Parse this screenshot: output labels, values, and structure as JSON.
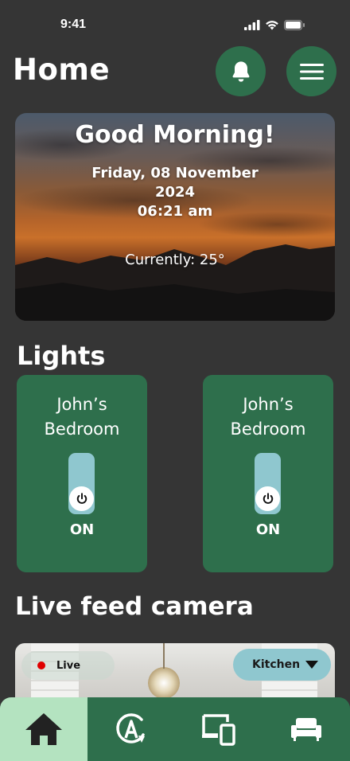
{
  "status": {
    "time": "9:41"
  },
  "header": {
    "title": "Home"
  },
  "hero": {
    "greeting": "Good Morning!",
    "date_line1": "Friday, 08 November",
    "date_line2": "2024",
    "time": "06:21 am",
    "current": "Currently: 25°"
  },
  "lights": {
    "title": "Lights",
    "cards": [
      {
        "name_line1": "John’s",
        "name_line2": "Bedroom",
        "state": "ON"
      },
      {
        "name_line1": "John’s",
        "name_line2": "Bedroom",
        "state": "ON"
      }
    ]
  },
  "camera": {
    "title": "Live feed camera",
    "live_label": "Live",
    "room": "Kitchen"
  },
  "nav": {
    "items": [
      {
        "icon": "home-icon",
        "active": true
      },
      {
        "icon": "automation-icon",
        "active": false
      },
      {
        "icon": "devices-icon",
        "active": false
      },
      {
        "icon": "sofa-icon",
        "active": false
      }
    ]
  },
  "colors": {
    "background": "#353535",
    "primary": "#2e6f4c",
    "accent": "#8fc7cf",
    "active_tab": "#b4e3c0"
  }
}
